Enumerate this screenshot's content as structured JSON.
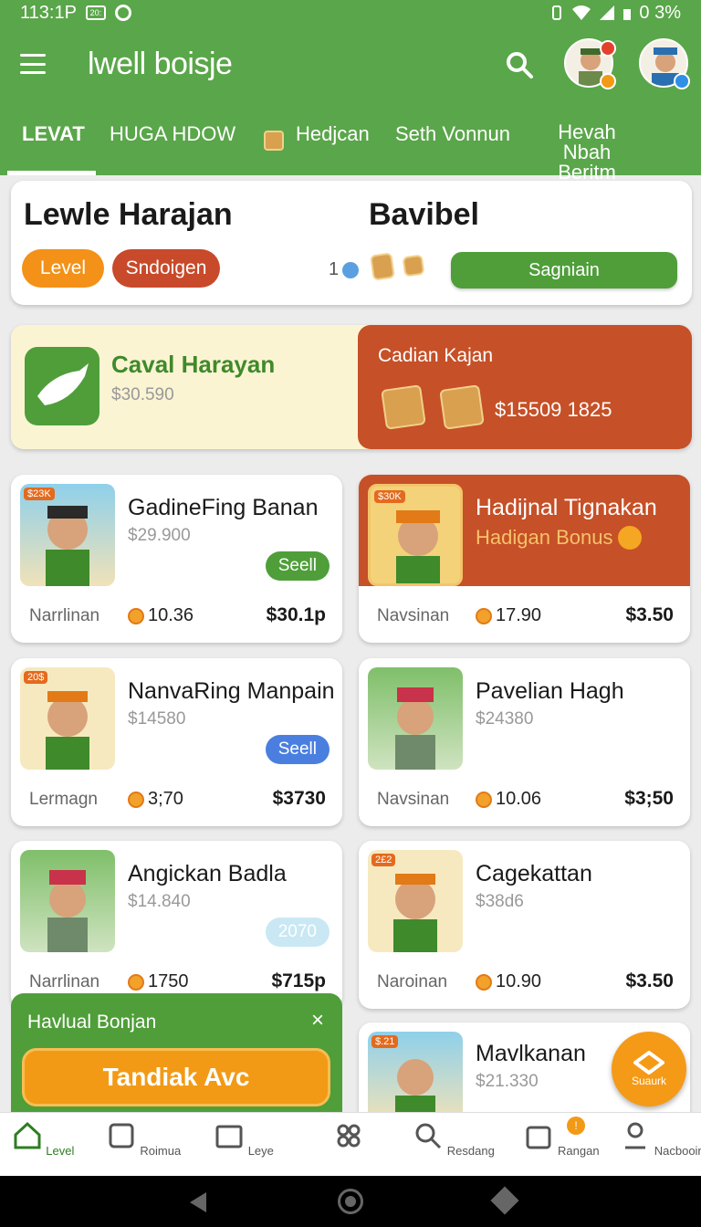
{
  "status": {
    "time": "113:1P",
    "box": "20:",
    "battery": "0 3%"
  },
  "app": {
    "title": "lwell boisje"
  },
  "tabs": [
    {
      "label": "LEVAT"
    },
    {
      "label": "HUGA HDOW"
    },
    {
      "label": "Hedjcan"
    },
    {
      "label": "Seth Vonnun"
    },
    {
      "label": "Hevah Nbah Beritm"
    }
  ],
  "header": {
    "left_title": "Lewle Harajan",
    "right_title": "Bavibel",
    "pill_level": "Level",
    "pill_sndoigen": "Sndoigen",
    "count": "1",
    "button": "Sagniain"
  },
  "promo": {
    "left_title": "Caval Harayan",
    "left_sub": "$30.590",
    "right_title": "Cadian Kajan",
    "right_amount": "$15509 1825"
  },
  "games": [
    {
      "title": "GadineFing Banan",
      "price": "$29.900",
      "button": "Seell",
      "footer": "Narrlinan",
      "coins": "10.36",
      "amount": "$30.1p",
      "tag": "$23K"
    },
    {
      "title": "Hadijnal Tignakan",
      "bonus": "Hadigan Bonus",
      "footer": "Navsinan",
      "coins": "17.90",
      "amount": "$3.50",
      "tag": "$30K"
    },
    {
      "title": "NanvaRing Manpain",
      "price": "$14580",
      "button": "Seell",
      "footer": "Lermagn",
      "coins": "3;70",
      "amount": "$3730",
      "tag": "20$"
    },
    {
      "title": "Pavelian Hagh",
      "price": "$24380",
      "footer": "Navsinan",
      "coins": "10.06",
      "amount": "$3;50"
    },
    {
      "title": "Angickan Badla",
      "price": "$14.840",
      "button": "2070",
      "footer": "Narrlinan",
      "coins": "1750",
      "amount": "$715p"
    },
    {
      "title": "Cagekattan",
      "price": "$38d6",
      "footer": "Naroinan",
      "coins": "10.90",
      "amount": "$3.50",
      "tag": "2£2"
    },
    {
      "title": "Mavlkanan",
      "price": "$21.330",
      "tag": "$.21"
    }
  ],
  "notification": {
    "title": "Havlual Bonjan",
    "close": "×",
    "button": "Tandiak Avc"
  },
  "fab": {
    "label": "Suaurk"
  },
  "bottom_nav": [
    {
      "label": "Level"
    },
    {
      "label": "Roimua"
    },
    {
      "label": "Leye"
    },
    {
      "label": ""
    },
    {
      "label": "Resdang"
    },
    {
      "label": "Rangan",
      "badge": "!"
    },
    {
      "label": "Nacbooinp"
    }
  ],
  "colors": {
    "brand_green": "#5aa64a",
    "accent_orange": "#f29a16",
    "accent_red": "#c65027"
  }
}
